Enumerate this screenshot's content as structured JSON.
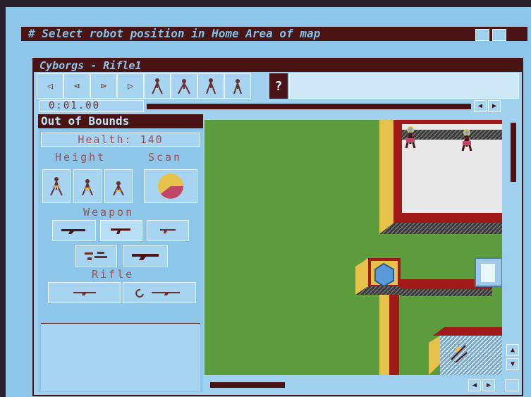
{
  "topbar": {
    "title": "# Select robot position in Home Area of map"
  },
  "window": {
    "title": "Cyborgs - Rifle1"
  },
  "toolbar": {
    "tools": [
      {
        "icon": "arrow-left-icon",
        "glyph": "◁"
      },
      {
        "icon": "step-back-icon",
        "glyph": "⊲"
      },
      {
        "icon": "step-forward-icon",
        "glyph": "⊳"
      },
      {
        "icon": "play-icon",
        "glyph": "▷"
      },
      {
        "icon": "robot-icon-1"
      },
      {
        "icon": "robot-icon-2"
      },
      {
        "icon": "robot-icon-3"
      },
      {
        "icon": "robot-icon-4"
      }
    ],
    "help_label": "?",
    "timer": "0:01.00"
  },
  "panel": {
    "title": "Out of Bounds",
    "health": "Health: 140",
    "height_label": "Height",
    "scan_label": "Scan",
    "weapon_label": "Weapon",
    "rifle_label": "Rifle"
  },
  "colors": {
    "frame": "#4a1414",
    "panel": "#8ec6ea",
    "grass": "#5c9c3c",
    "floor": "#e8e8ea"
  }
}
